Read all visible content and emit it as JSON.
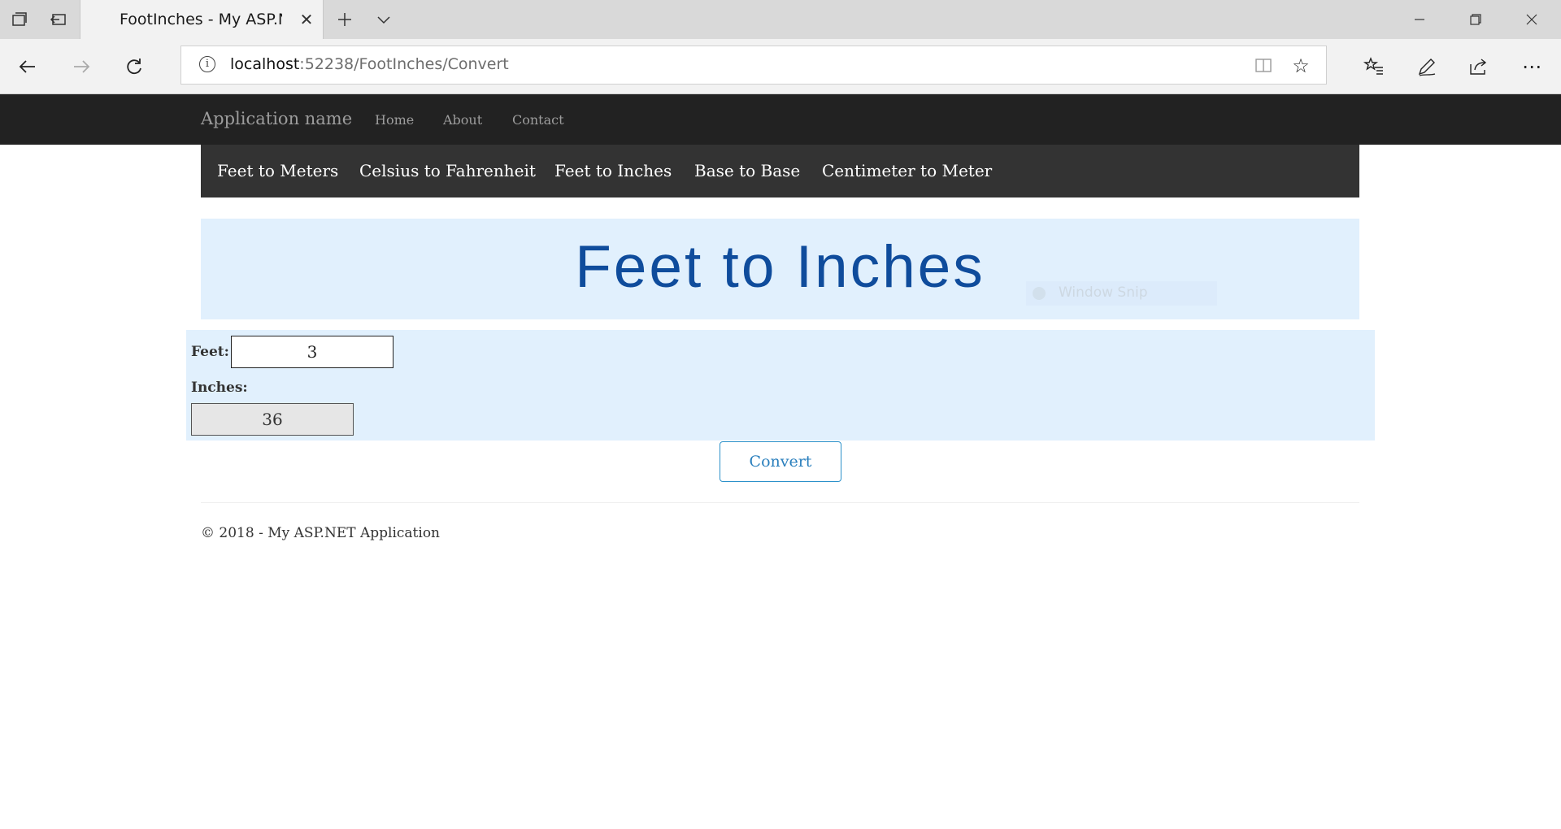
{
  "browser": {
    "tab_title": "FootInches - My ASP.NE",
    "url_host": "localhost",
    "url_rest": ":52238/FootInches/Convert",
    "icons": [
      "tab-list-icon",
      "set-aside-icon",
      "new-tab-icon",
      "tab-dropdown-icon",
      "back-icon",
      "forward-icon",
      "refresh-icon",
      "info-icon",
      "reading-view-icon",
      "favorite-star-icon",
      "favorites-icon",
      "pen-icon",
      "share-icon",
      "more-icon",
      "minimize-icon",
      "restore-icon",
      "close-icon"
    ]
  },
  "site": {
    "brand": "Application name",
    "nav": [
      "Home",
      "About",
      "Contact"
    ]
  },
  "subnav": [
    "Feet to Meters",
    "Celsius to Fahrenheit",
    "Feet to Inches",
    "Base to Base",
    "Centimeter to Meter"
  ],
  "main": {
    "heading": "Feet to Inches",
    "feet_label": "Feet:",
    "feet_value": "3",
    "inches_label": "Inches:",
    "inches_value": "36",
    "convert_label": "Convert"
  },
  "overlay": {
    "snip_label": "Window Snip"
  },
  "footer": {
    "text": "© 2018 - My ASP.NET Application"
  },
  "colors": {
    "navbar": "#222222",
    "subnav": "#333333",
    "panel": "#e1f0fd",
    "heading": "#0f4c9c",
    "button_border": "#2a90c9"
  }
}
